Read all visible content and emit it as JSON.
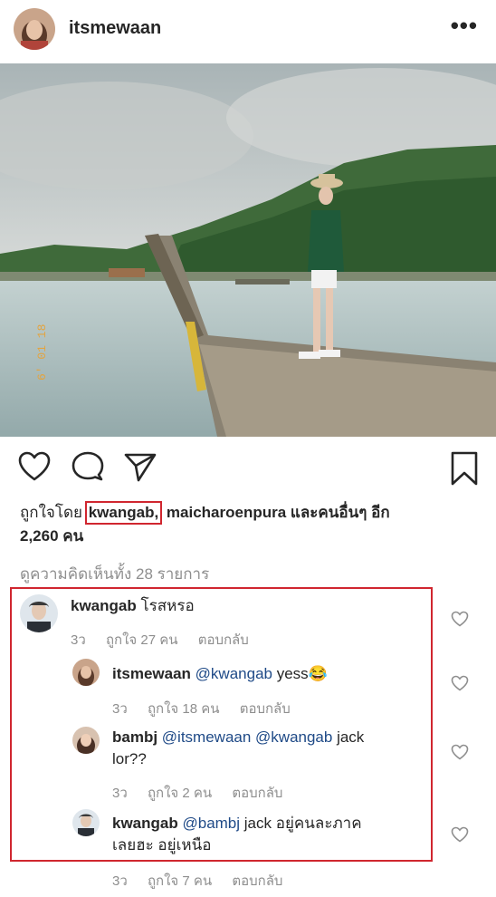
{
  "header": {
    "username": "itsmewaan",
    "more_label": "•••"
  },
  "photo": {
    "timestamp": "6' 01 18"
  },
  "likes": {
    "prefix": "ถูกใจโดย",
    "user1": "kwangab,",
    "user2": "maicharoenpura",
    "suffix": "และคนอื่นๆ อีก",
    "count": "2,260 คน"
  },
  "view_all": "ดูความคิดเห็นทั้ง 28 รายการ",
  "comments": [
    {
      "user": "kwangab",
      "mention": "",
      "text": "โรสหรอ",
      "text2": "",
      "time": "3ว",
      "likes": "ถูกใจ 27 คน",
      "reply": "ตอบกลับ"
    },
    {
      "user": "itsmewaan",
      "mention": "@kwangab",
      "text": "yess😂",
      "text2": "",
      "time": "3ว",
      "likes": "ถูกใจ 18 คน",
      "reply": "ตอบกลับ"
    },
    {
      "user": "bambj",
      "mention": "@itsmewaan @kwangab",
      "text": "jack",
      "text2": "lor??",
      "time": "3ว",
      "likes": "ถูกใจ 2 คน",
      "reply": "ตอบกลับ"
    },
    {
      "user": "kwangab",
      "mention": "@bambj",
      "text": "jack อยู่คนละภาค",
      "text2": "เลยฮะ อยู่เหนือ",
      "time": "3ว",
      "likes": "ถูกใจ 7 คน",
      "reply": "ตอบกลับ"
    }
  ]
}
